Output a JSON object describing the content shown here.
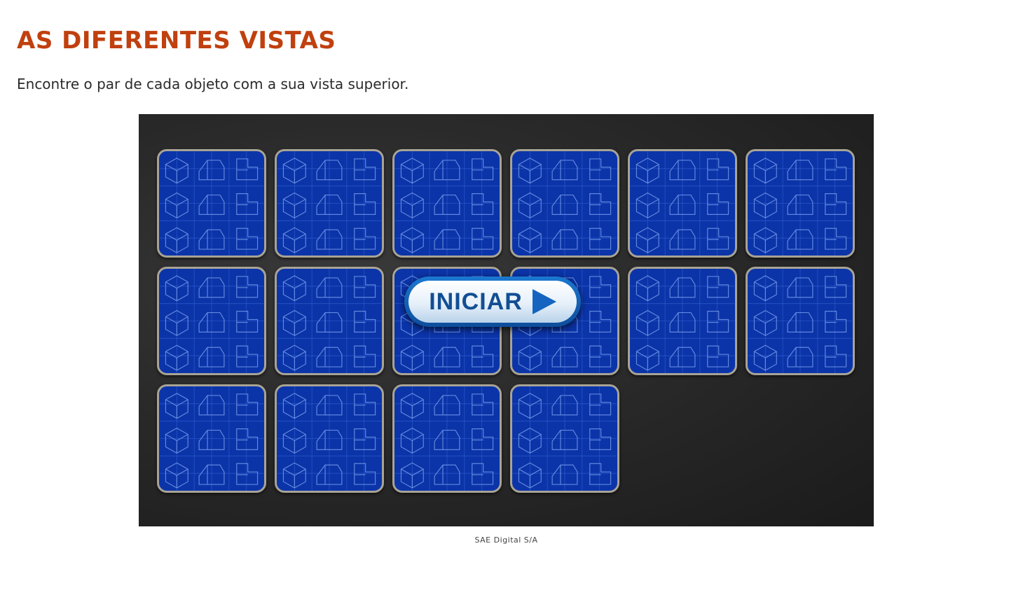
{
  "header": {
    "title": "AS DIFERENTES VISTAS",
    "instructions": "Encontre o par de cada objeto com a sua vista superior."
  },
  "game": {
    "start_button_label": "INICIAR",
    "start_button_icon": "play-arrow-icon",
    "card_count": 16,
    "card_back_pattern": "blueprint-isometric-shapes",
    "colors": {
      "card_back": "#0b34a8",
      "card_border": "#a8a395",
      "board_background": "#2a2a2a",
      "button_text": "#124e93"
    }
  },
  "footer": {
    "credit": "SAE Digital S/A"
  },
  "colors": {
    "title": "#c0400f"
  }
}
